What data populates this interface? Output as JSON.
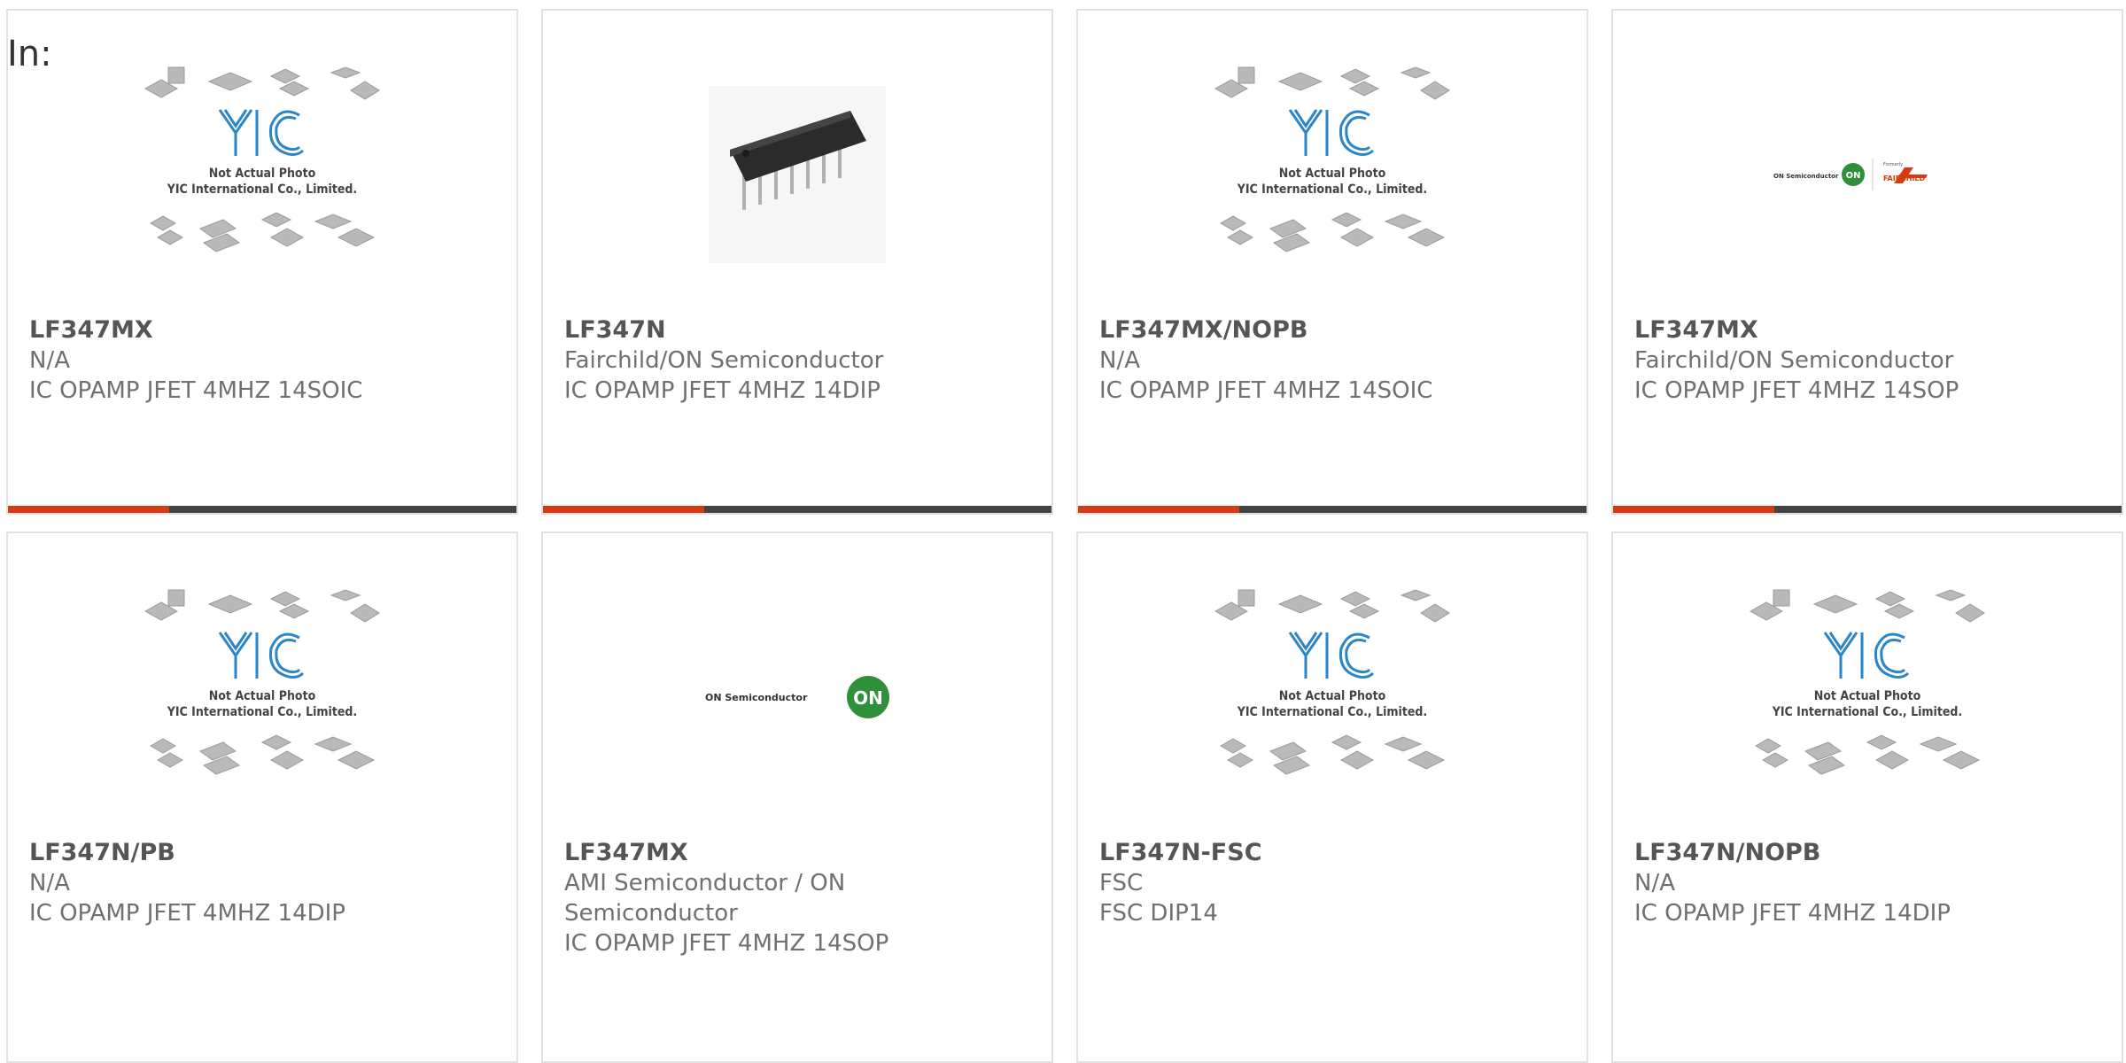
{
  "header": {
    "in_label": "In:"
  },
  "placeholder": {
    "logo_text": "YIC",
    "line1": "Not Actual Photo",
    "line2": "YIC International Co., Limited."
  },
  "brand_logos": {
    "on_semi_text": "ON Semiconductor",
    "on_mark": "ON",
    "formerly": "Formerly",
    "fairchild": "FAIRCHILD"
  },
  "colors": {
    "accent": "#d73a11",
    "bar": "#444444",
    "border": "#e1e1e1",
    "yic_blue": "#2a86c8",
    "on_green": "#2f8f3a"
  },
  "products": [
    {
      "part": "LF347MX",
      "manufacturer": "N/A",
      "description": "IC OPAMP JFET 4MHZ 14SOIC",
      "image": "yic-placeholder"
    },
    {
      "part": "LF347N",
      "manufacturer": "Fairchild/ON Semiconductor",
      "description": "IC OPAMP JFET 4MHZ 14DIP",
      "image": "dip14-chip-photo"
    },
    {
      "part": "LF347MX/NOPB",
      "manufacturer": "N/A",
      "description": "IC OPAMP JFET 4MHZ 14SOIC",
      "image": "yic-placeholder"
    },
    {
      "part": "LF347MX",
      "manufacturer": "Fairchild/ON Semiconductor",
      "description": "IC OPAMP JFET 4MHZ 14SOP",
      "image": "on-fairchild-logo"
    },
    {
      "part": "LF347N/PB",
      "manufacturer": "N/A",
      "description": "IC OPAMP JFET 4MHZ 14DIP",
      "image": "yic-placeholder"
    },
    {
      "part": "LF347MX",
      "manufacturer": "AMI Semiconductor / ON Semiconductor",
      "description": "IC OPAMP JFET 4MHZ 14SOP",
      "image": "on-semi-logo"
    },
    {
      "part": "LF347N-FSC",
      "manufacturer": "FSC",
      "description": "FSC DIP14",
      "image": "yic-placeholder"
    },
    {
      "part": "LF347N/NOPB",
      "manufacturer": "N/A",
      "description": "IC OPAMP JFET 4MHZ 14DIP",
      "image": "yic-placeholder"
    }
  ]
}
